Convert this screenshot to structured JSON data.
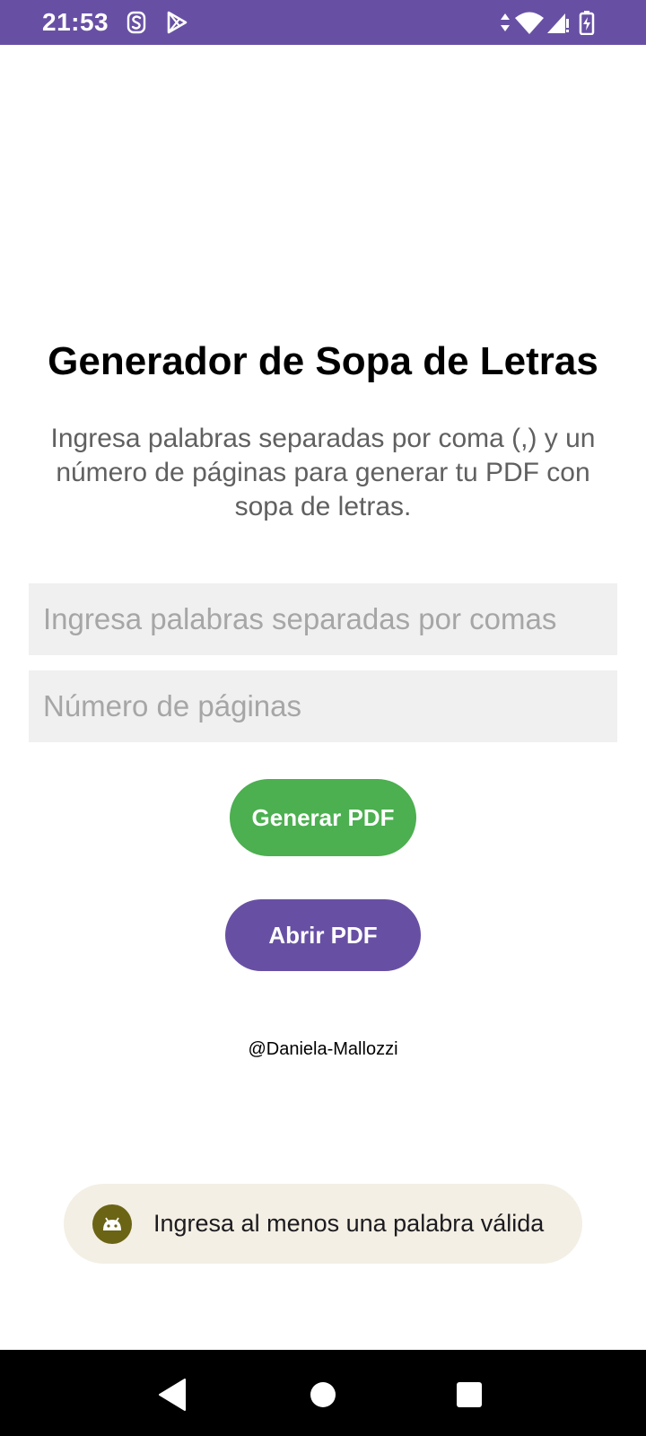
{
  "status_bar": {
    "time": "21:53",
    "left_icons": [
      "notification-s-icon",
      "play-store-icon"
    ],
    "right_icons": [
      "data-arrows-icon",
      "wifi-icon",
      "cell-signal-icon",
      "battery-charging-icon"
    ],
    "background_color": "#6750a4"
  },
  "main": {
    "title": "Generador de Sopa de Letras",
    "description": "Ingresa palabras separadas por coma (,) y un número de páginas para generar tu PDF con sopa de letras.",
    "words_input": {
      "placeholder": "Ingresa palabras separadas por comas",
      "value": ""
    },
    "pages_input": {
      "placeholder": "Número de páginas",
      "value": ""
    },
    "generate_button": {
      "label": "Generar PDF",
      "color": "#4caf50"
    },
    "open_button": {
      "label": "Abrir PDF",
      "color": "#6750a4"
    },
    "credit": "@Daniela-Mallozzi"
  },
  "toast": {
    "icon": "android-icon",
    "message": "Ingresa al menos una palabra válida"
  },
  "nav_bar": {
    "buttons": [
      "back-icon",
      "home-icon",
      "recents-icon"
    ]
  }
}
